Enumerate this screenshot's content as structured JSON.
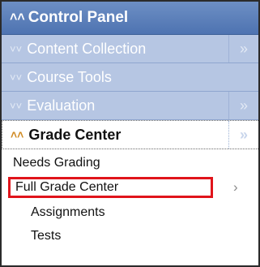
{
  "panel": {
    "title": "Control Panel",
    "title_icon": "double-chevron-up-icon"
  },
  "nav": [
    {
      "label": "Content Collection",
      "icon": "double-chevron-down-icon",
      "expand": "»"
    },
    {
      "label": "Course Tools",
      "icon": "double-chevron-down-icon"
    },
    {
      "label": "Evaluation",
      "icon": "double-chevron-down-icon",
      "expand": "»"
    },
    {
      "label": "Grade Center",
      "icon": "double-chevron-up-icon",
      "expand": "»"
    }
  ],
  "grade_center": {
    "items": [
      {
        "label": "Needs Grading"
      },
      {
        "label": "Full Grade Center",
        "arrow": "›"
      },
      {
        "label": "Assignments"
      },
      {
        "label": "Tests"
      }
    ]
  },
  "colors": {
    "header": "#4e73b1",
    "nav": "#b6c6e3",
    "highlight": "#e0141b",
    "active_chevron": "#d08a22"
  }
}
